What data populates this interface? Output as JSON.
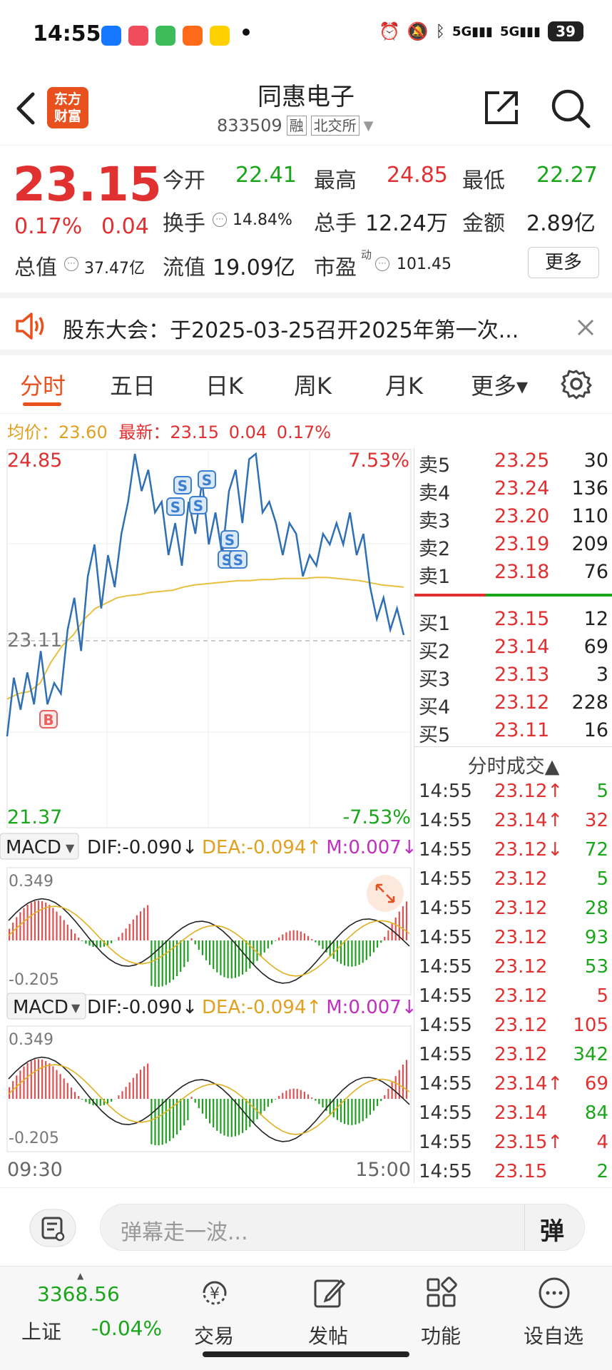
{
  "status_bar": {
    "time": "14:55",
    "battery": "39",
    "signal1": "5G",
    "signal2": "5G"
  },
  "header": {
    "stock_name": "同惠电子",
    "stock_code": "833509",
    "tag_margin": "融",
    "exchange": "北交所",
    "logo_line1": "东方",
    "logo_line2": "财富"
  },
  "quote": {
    "price": "23.15",
    "change_pct": "0.17%",
    "change": "0.04",
    "open_label": "今开",
    "open": "22.41",
    "high_label": "最高",
    "high": "24.85",
    "low_label": "最低",
    "low": "22.27",
    "turnover_label": "换手",
    "turnover": "14.84%",
    "volume_label": "总手",
    "volume": "12.24万",
    "amount_label": "金额",
    "amount": "2.89亿",
    "mktcap_label": "总值",
    "mktcap": "37.47亿",
    "float_label": "流值",
    "float_cap": "19.09亿",
    "pe_label": "市盈",
    "pe_sup": "动",
    "pe": "101.45",
    "more": "更多"
  },
  "notice": {
    "text": "股东大会：于2025-03-25召开2025年第一次..."
  },
  "tabs": [
    {
      "label": "分时",
      "active": true
    },
    {
      "label": "五日"
    },
    {
      "label": "日K"
    },
    {
      "label": "周K"
    },
    {
      "label": "月K"
    },
    {
      "label": "更多▾"
    }
  ],
  "avg_line": {
    "avg_label": "均价：",
    "avg": "23.60",
    "latest_label": "最新：",
    "latest": "23.15",
    "chg": "0.04",
    "pct": "0.17%"
  },
  "chart_data": [
    {
      "type": "line",
      "title": "",
      "x_axis": [
        "09:30",
        "15:00"
      ],
      "y_max_label": "24.85",
      "y_min_label": "21.37",
      "ref_price": "23.11",
      "pct_max": "7.53%",
      "pct_min": "-7.53%",
      "series": [
        {
          "values": [
            22.2,
            22.75,
            22.45,
            22.8,
            22.5,
            23.0,
            22.5,
            22.7,
            22.6,
            23.2,
            23.5,
            23.0,
            23.7,
            24.0,
            23.4,
            23.9,
            23.6,
            24.1,
            24.4,
            24.85,
            24.5,
            24.7,
            24.3,
            24.4,
            23.9,
            24.2,
            23.8,
            24.4,
            24.1,
            24.6,
            24.0,
            24.3,
            23.9,
            24.5,
            24.7,
            24.2,
            24.8,
            24.85,
            24.3,
            24.4,
            24.2,
            23.9,
            24.2,
            24.1,
            23.7,
            23.9,
            23.8,
            24.1,
            24.0,
            24.2,
            24.0,
            24.3,
            23.9,
            24.1,
            23.6,
            23.3,
            23.5,
            23.2,
            23.4,
            23.15
          ]
        },
        {
          "values": [
            22.55,
            22.6,
            22.62,
            22.7,
            22.9,
            23.05,
            23.15,
            23.3,
            23.4,
            23.45,
            23.5,
            23.52,
            23.53,
            23.55,
            23.56,
            23.57,
            23.6,
            23.62,
            23.63,
            23.64,
            23.65,
            23.66,
            23.66,
            23.67,
            23.67,
            23.68,
            23.68,
            23.68,
            23.69,
            23.69,
            23.68,
            23.67,
            23.66,
            23.64,
            23.62,
            23.61,
            23.6
          ]
        }
      ],
      "markers": [
        "B",
        "S",
        "S",
        "S",
        "S",
        "S",
        "S",
        "S"
      ]
    },
    {
      "type": "bar",
      "title": "MACD",
      "dif_label": "DIF:",
      "dif": "-0.090",
      "dea_label": "DEA:",
      "dea": "-0.094",
      "m_label": "M:",
      "m": "0.007",
      "y_max_label": "0.349",
      "y_min_label": "-0.205"
    },
    {
      "type": "bar",
      "title": "MACD",
      "dif_label": "DIF:",
      "dif": "-0.090",
      "dea_label": "DEA:",
      "dea": "-0.094",
      "m_label": "M:",
      "m": "0.007",
      "y_max_label": "0.349",
      "y_min_label": "-0.205"
    }
  ],
  "orderbook": {
    "asks": [
      {
        "label": "卖5",
        "price": "23.25",
        "vol": "30"
      },
      {
        "label": "卖4",
        "price": "23.24",
        "vol": "136"
      },
      {
        "label": "卖3",
        "price": "23.20",
        "vol": "110"
      },
      {
        "label": "卖2",
        "price": "23.19",
        "vol": "209"
      },
      {
        "label": "卖1",
        "price": "23.18",
        "vol": "76"
      }
    ],
    "bids": [
      {
        "label": "买1",
        "price": "23.15",
        "vol": "12"
      },
      {
        "label": "买2",
        "price": "23.14",
        "vol": "69"
      },
      {
        "label": "买3",
        "price": "23.13",
        "vol": "3"
      },
      {
        "label": "买4",
        "price": "23.12",
        "vol": "228"
      },
      {
        "label": "买5",
        "price": "23.11",
        "vol": "16"
      }
    ],
    "ticks_title": "分时成交▲",
    "ticks": [
      {
        "time": "14:55",
        "price": "23.12↑",
        "vol": "5",
        "pc": "red",
        "vc": "green"
      },
      {
        "time": "14:55",
        "price": "23.14↑",
        "vol": "32",
        "pc": "red",
        "vc": "red"
      },
      {
        "time": "14:55",
        "price": "23.12↓",
        "vol": "72",
        "pc": "red",
        "vc": "green"
      },
      {
        "time": "14:55",
        "price": "23.12",
        "vol": "5",
        "pc": "red",
        "vc": "green"
      },
      {
        "time": "14:55",
        "price": "23.12",
        "vol": "28",
        "pc": "red",
        "vc": "green"
      },
      {
        "time": "14:55",
        "price": "23.12",
        "vol": "93",
        "pc": "red",
        "vc": "green"
      },
      {
        "time": "14:55",
        "price": "23.12",
        "vol": "53",
        "pc": "red",
        "vc": "green"
      },
      {
        "time": "14:55",
        "price": "23.12",
        "vol": "5",
        "pc": "red",
        "vc": "red"
      },
      {
        "time": "14:55",
        "price": "23.12",
        "vol": "105",
        "pc": "red",
        "vc": "red"
      },
      {
        "time": "14:55",
        "price": "23.12",
        "vol": "342",
        "pc": "red",
        "vc": "green"
      },
      {
        "time": "14:55",
        "price": "23.14↑",
        "vol": "69",
        "pc": "red",
        "vc": "red"
      },
      {
        "time": "14:55",
        "price": "23.14",
        "vol": "84",
        "pc": "red",
        "vc": "green"
      },
      {
        "time": "14:55",
        "price": "23.15↑",
        "vol": "4",
        "pc": "red",
        "vc": "red"
      },
      {
        "time": "14:55",
        "price": "23.15",
        "vol": "2",
        "pc": "red",
        "vc": "green"
      }
    ]
  },
  "danmaku": {
    "placeholder": "弹幕走一波...",
    "button": "弹"
  },
  "bottom_nav": {
    "index_value": "3368.56",
    "index_name": "上证",
    "index_change": "-0.04%",
    "items": [
      "交易",
      "发帖",
      "功能",
      "设自选"
    ]
  }
}
